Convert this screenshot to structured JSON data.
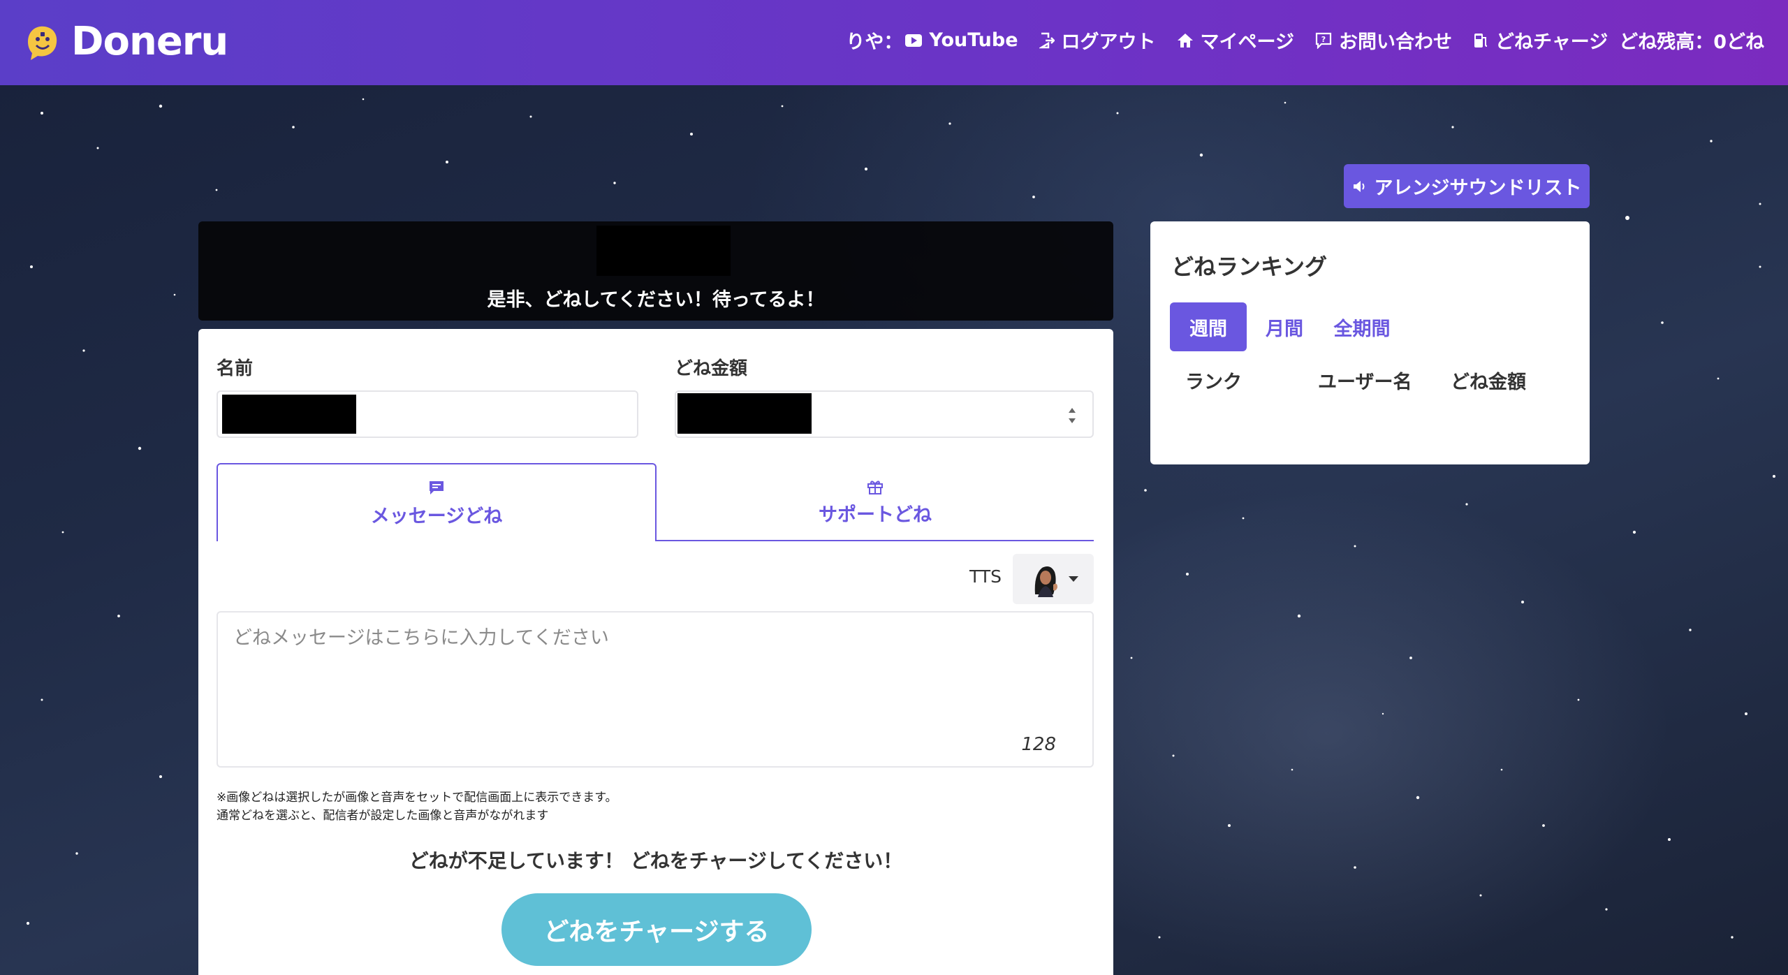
{
  "brand": {
    "name": "Doneru"
  },
  "nav": {
    "user_prefix": "りや：",
    "youtube_label": "YouTube",
    "logout_label": "ログアウト",
    "mypage_label": "マイページ",
    "contact_label": "お問い合わせ",
    "charge_label": "どねチャージ",
    "balance_label": "どね残高：0どね"
  },
  "header": {
    "subtitle": "是非、どねしてください！待ってるよ！"
  },
  "form": {
    "name_label": "名前",
    "amount_label": "どね金額",
    "tabs": [
      {
        "label": "メッセージどね",
        "icon": "message-icon",
        "active": true
      },
      {
        "label": "サポートどね",
        "icon": "gift-icon",
        "active": false
      }
    ],
    "tts_label": "TTS",
    "message_placeholder": "どねメッセージはこちらに入力してください",
    "char_count": "128",
    "notice_line1": "※画像どねは選択したが画像と音声をセットで配信画面上に表示できます。",
    "notice_line2": "通常どねを選ぶと、配信者が設定した画像と音声がながれます",
    "warning": "どねが不足しています！ どねをチャージしてください！",
    "charge_button": "どねをチャージする"
  },
  "sidebar": {
    "sound_list_button": "アレンジサウンドリスト",
    "ranking_title": "どねランキング",
    "ranking_tabs": [
      "週間",
      "月間",
      "全期間"
    ],
    "ranking_columns": [
      "ランク",
      "ユーザー名",
      "どね金額"
    ]
  },
  "colors": {
    "accent": "#6a57e0",
    "navbar_start": "#5b3ec8",
    "navbar_end": "#7b2bbf",
    "charge_button": "#5fc0d6"
  }
}
